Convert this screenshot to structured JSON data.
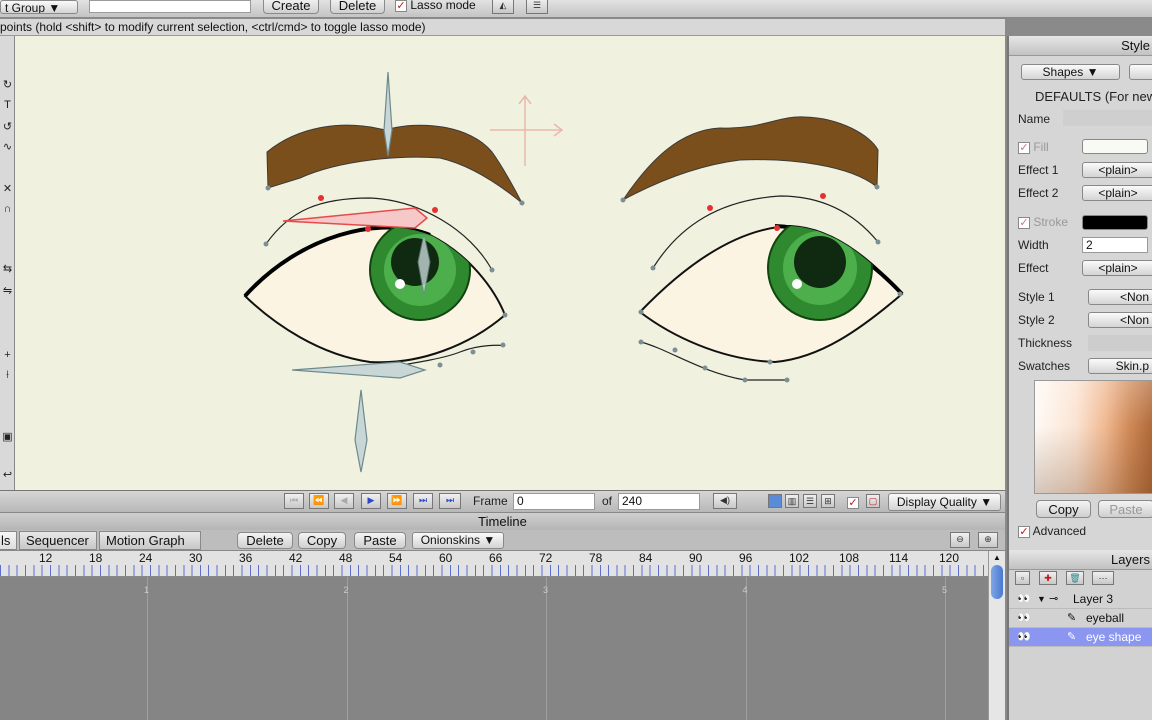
{
  "topbar": {
    "group_select": "t Group",
    "create_label": "Create",
    "delete_label": "Delete",
    "lasso_label": "Lasso mode"
  },
  "hint": "points (hold <shift> to modify current selection, <ctrl/cmd> to toggle lasso mode)",
  "framebar": {
    "frame_label": "Frame",
    "frame_value": "0",
    "of_label": "of",
    "total_frames": "240",
    "display_quality": "Display Quality"
  },
  "timeline": {
    "title": "Timeline",
    "tabs": [
      "ls",
      "Sequencer",
      "Motion Graph"
    ],
    "buttons": {
      "delete": "Delete",
      "copy": "Copy",
      "paste": "Paste",
      "onionskins": "Onionskins"
    },
    "ruler_ticks": [
      "12",
      "18",
      "24",
      "30",
      "36",
      "42",
      "48",
      "54",
      "60",
      "66",
      "72",
      "78",
      "84",
      "90",
      "96",
      "102",
      "108",
      "114",
      "120"
    ],
    "track_markers": [
      "1",
      "2",
      "3",
      "4",
      "5"
    ]
  },
  "style_panel": {
    "title": "Style",
    "shapes_popup": "Shapes",
    "defaults_text": "DEFAULTS (For new",
    "name_label": "Name",
    "fill_label": "Fill",
    "effect1_label": "Effect 1",
    "effect1_value": "<plain>",
    "effect2_label": "Effect 2",
    "effect2_value": "<plain>",
    "stroke_label": "Stroke",
    "width_label": "Width",
    "width_value": "2",
    "effect_label": "Effect",
    "effect_value": "<plain>",
    "style1_label": "Style 1",
    "style1_value": "<Non",
    "style2_label": "Style 2",
    "style2_value": "<Non",
    "thickness_label": "Thickness",
    "swatches_label": "Swatches",
    "swatches_value": "Skin.p",
    "copy_label": "Copy",
    "paste_label": "Paste",
    "advanced_label": "Advanced",
    "fill_color": "#f7fbf4",
    "stroke_color": "#000000"
  },
  "layers_panel": {
    "title": "Layers",
    "rows": [
      {
        "label": "Layer 3"
      },
      {
        "label": "eyeball"
      },
      {
        "label": "eye shape"
      }
    ],
    "selected_color": "#8a96f0"
  },
  "colors": {
    "canvas_bg": "#f1f1e0",
    "brow": "#7a4f1c",
    "iris": "#2f8a2f",
    "sclera": "#fcf4e2",
    "bone_red": "#e84a4a"
  }
}
